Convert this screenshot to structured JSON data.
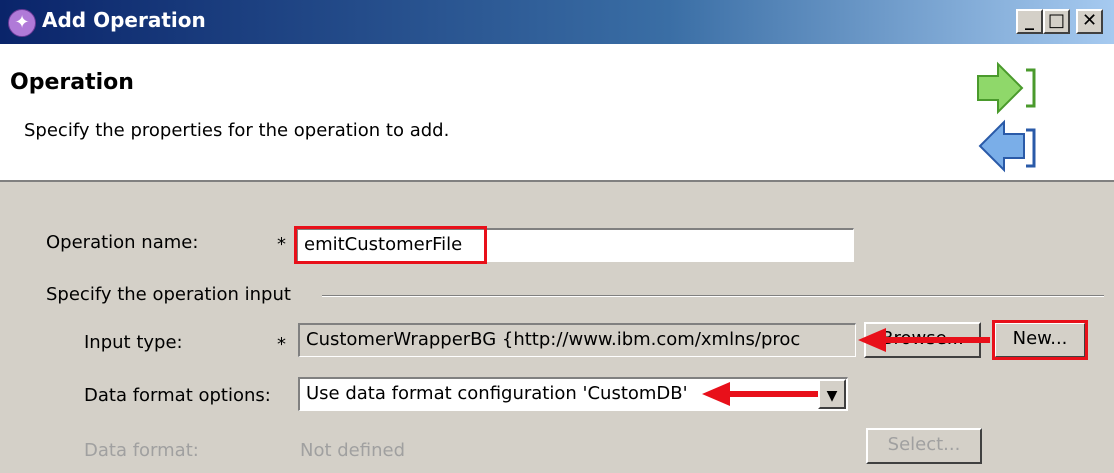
{
  "window": {
    "title": "Add Operation",
    "controls": {
      "minimize": "_",
      "maximize": "□",
      "close": "✕"
    }
  },
  "header": {
    "title": "Operation",
    "description": "Specify the properties for the operation to add."
  },
  "form": {
    "operation_name_label": "Operation name:",
    "required_marker": "*",
    "operation_name_value": "emitCustomerFile",
    "input_group_label": "Specify the operation input",
    "input_type_label": "Input type:",
    "input_type_value": "CustomerWrapperBG  {http://www.ibm.com/xmlns/proc",
    "browse_button": "Browse...",
    "new_button": "New...",
    "data_format_options_label": "Data format options:",
    "data_format_options_value": "Use data format configuration 'CustomDB'",
    "data_format_label": "Data format:",
    "data_format_value": "Not defined",
    "select_button": "Select..."
  },
  "colors": {
    "highlight": "#e8101a",
    "dialog_bg": "#d4d0c8",
    "titlebar": "#0a246a"
  }
}
